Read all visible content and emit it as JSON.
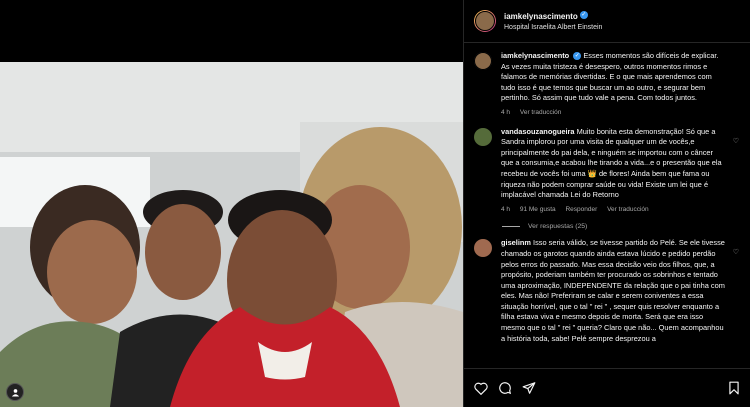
{
  "post": {
    "username": "iamkelynascimento",
    "location": "Hospital Israelita Albert Einstein"
  },
  "comments": [
    {
      "username": "iamkelynascimento",
      "text": "Esses momentos são difíceis de explicar. As vezes muita tristeza é desespero, outros momentos rimos e falamos de memórias divertidas. E o que mais aprendemos com tudo isso é que temos que buscar um ao outro, e segurar bem pertinho. Só assim que tudo vale a pena. Com todos juntos.",
      "time": "4 h",
      "translate": "Ver traducción"
    },
    {
      "username": "vandasouzanogueira",
      "text": "Muito bonita esta demonstração! Só que a Sandra implorou por uma visita de qualquer um de vocês,e principalmente do pai dela, e ninguém se importou com o câncer que a consumia,e acabou lhe tirando a vida...e o presentão que ela recebeu de vocês foi uma 👑 de flores! Ainda bem que fama ou riqueza não podem comprar saúde ou vida! Existe um lei que é implacável chamada Lei do Retorno",
      "time": "4 h",
      "likes": "91 Me gusta",
      "reply": "Responder",
      "translate": "Ver traducción",
      "view_replies": "Ver respuestas (25)"
    },
    {
      "username": "giselinm",
      "text": "Isso seria válido, se tivesse partido do Pelé. Se ele tivesse chamado os garotos quando ainda estava lúcido e pedido perdão pelos erros do passado. Mas essa decisão veio dos filhos, que, a propósito, poderiam também ter procurado os sobrinhos e tentado uma aproximação, INDEPENDENTE da relação que o pai tinha com eles. Mas não! Preferiram se calar e serem coniventes a essa situação horrível, que o tal \" rei \" , sequer quis resolver enquanto a filha estava viva e mesmo depois de morta. Será que era isso mesmo que o tal \" rei \" queria? Claro que não... Quem acompanhou a história toda, sabe! Pelé sempre desprezou a"
    }
  ],
  "icons": {
    "like": "heart-icon",
    "comment": "comment-icon",
    "share": "send-icon",
    "save": "bookmark-icon",
    "tagged": "user-icon"
  }
}
